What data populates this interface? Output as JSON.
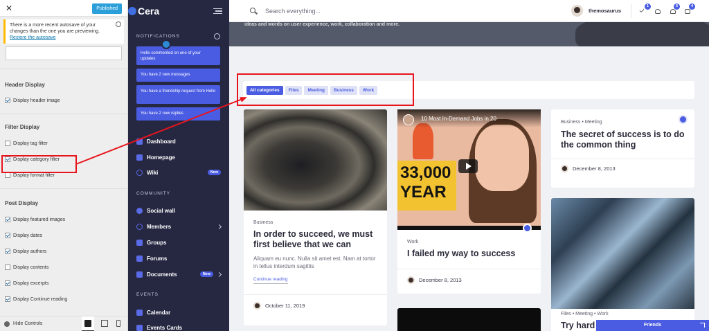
{
  "customizer": {
    "close": "✕",
    "publish_label": "Published",
    "notice_text": "There is a more recent autosave of your changes than the one you are previewing.",
    "notice_link": "Restore the autosave",
    "sections": [
      {
        "title": "Header Display",
        "options": [
          {
            "label": "Display header image",
            "checked": true
          }
        ]
      },
      {
        "title": "Filter Display",
        "options": [
          {
            "label": "Display tag filter",
            "checked": false
          },
          {
            "label": "Display category filter",
            "checked": true
          },
          {
            "label": "Display format filter",
            "checked": false
          }
        ]
      },
      {
        "title": "Post Display",
        "options": [
          {
            "label": "Display featured images",
            "checked": true
          },
          {
            "label": "Display dates",
            "checked": true
          },
          {
            "label": "Display authors",
            "checked": true
          },
          {
            "label": "Display contents",
            "checked": false
          },
          {
            "label": "Display excerpts",
            "checked": true
          },
          {
            "label": "Display Continue reading",
            "checked": true
          }
        ]
      }
    ],
    "hide_controls": "Hide Controls"
  },
  "sidenav": {
    "logo": "Cera",
    "notifications_heading": "NOTIFICATIONS",
    "notifications": [
      "Hello commented on one of your updates",
      "You have 2 new messages",
      "You have a friendship request from Hello",
      "You have 2 new replies"
    ],
    "main_items": [
      {
        "label": "Dashboard"
      },
      {
        "label": "Homepage"
      },
      {
        "label": "Wiki",
        "badge": "New"
      }
    ],
    "community_heading": "COMMUNITY",
    "community_items": [
      {
        "label": "Social wall"
      },
      {
        "label": "Members"
      },
      {
        "label": "Groups"
      },
      {
        "label": "Forums"
      },
      {
        "label": "Documents",
        "badge": "New"
      }
    ],
    "events_heading": "EVENTS",
    "events_items": [
      {
        "label": "Calendar"
      },
      {
        "label": "Events Cards"
      }
    ]
  },
  "topbar": {
    "search_placeholder": "Search everything...",
    "username": "themosaurus",
    "badges": {
      "check": "1",
      "friends": "5",
      "messages": "4"
    }
  },
  "hero_text": "ideas and words on user experience, work, collaboration and more.",
  "filters": [
    "All categories",
    "Files",
    "Meeting",
    "Business",
    "Work"
  ],
  "cards": {
    "c1": {
      "category": "Business",
      "title": "In order to succeed, we must first believe that we can",
      "excerpt": "Aliquam eu nunc. Nulla sit amet est. Nam at tortor in tellus interdum sagittis",
      "continue": "Continue reading",
      "date": "October 11, 2019"
    },
    "c2": {
      "video_title": "10 Most In-Demand Jobs in 20",
      "video_number": "33,000",
      "video_word": "YEAR",
      "category": "Work",
      "title": "I failed my way to success",
      "date": "December 8, 2013"
    },
    "c3": {
      "cat1": "Business",
      "cat2": "Meeting",
      "title": "The secret of success is to do the common thing",
      "date": "December 8, 2013"
    },
    "c4": {
      "cat1": "Files",
      "cat2": "Meeting",
      "cat3": "Work",
      "title": "Try hard"
    }
  },
  "friends_label": "Friends",
  "colors": {
    "accent": "#4a5de2",
    "sidebar": "#262842",
    "annotation": "#e8141c"
  }
}
